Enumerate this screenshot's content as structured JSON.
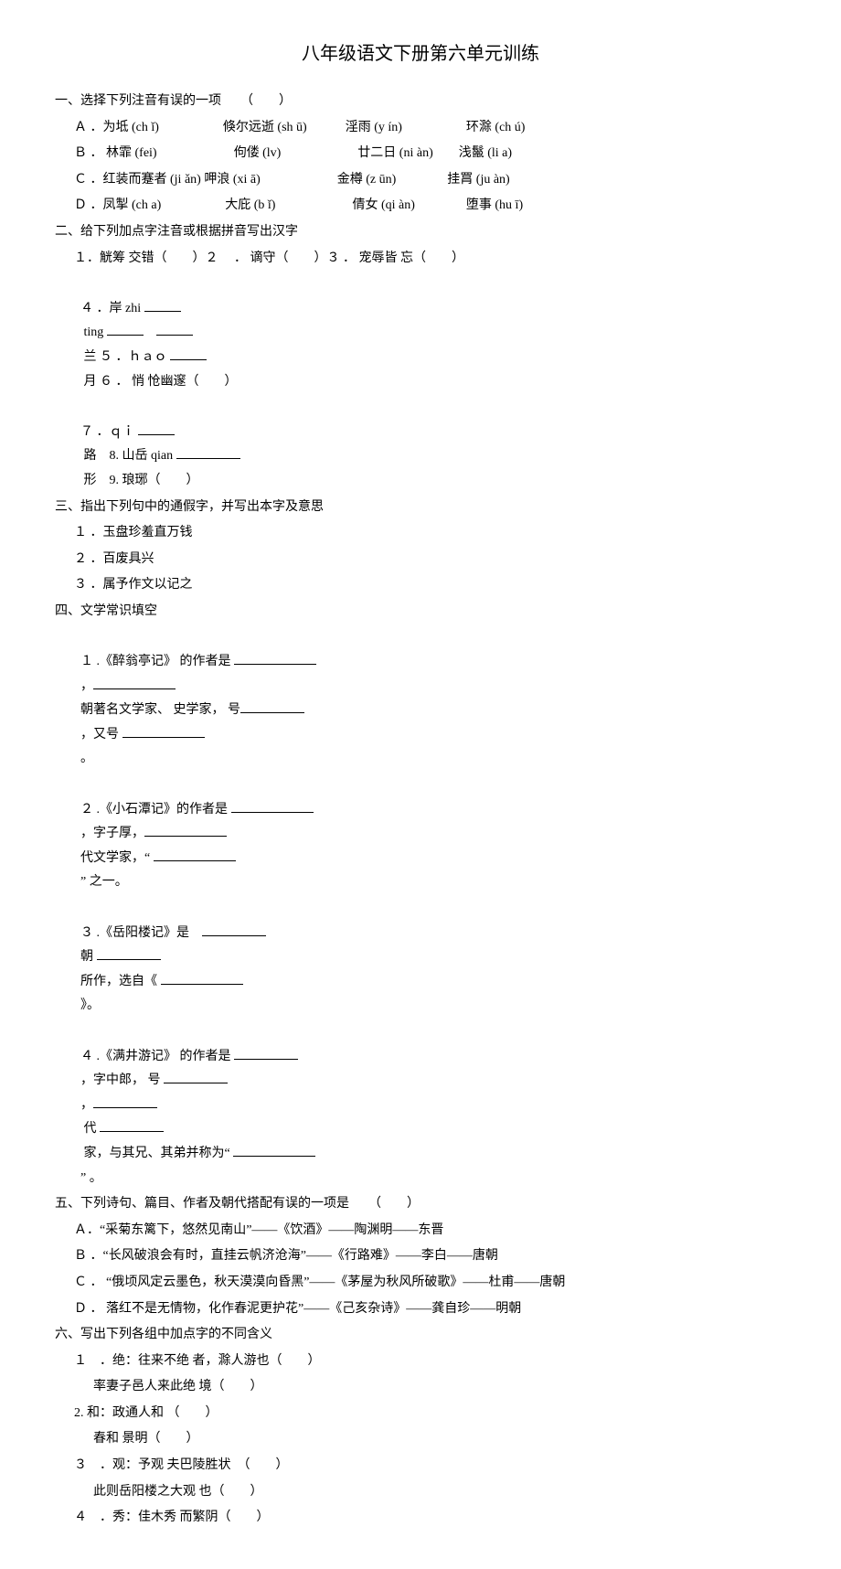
{
  "title": "八年级语文下册第六单元训练",
  "q1": {
    "heading": "一、选择下列注音有误的一项　　（　　）",
    "A": "Ａ ．为坻 (ch ǐ)　　　　　倏尔远逝 (sh ū)　　　淫雨 (y ín)　　　　　环滁 (ch ú)",
    "B": "Ｂ ． 林霏 (fei)　　　　　　佝偻 (lv)　　　　　　廿二日 (ni àn)　　浅鬣 (li a)",
    "C": "Ｃ ．红装而蹇者 (ji ǎn) 呷浪 (xi ā)　　　　　　金樽 (z ūn)　　　　挂罥 (ju àn)",
    "D": "Ｄ ．凤掣 (ch a)　　　　　大庇 (b ǐ)　　　　　　倩女 (qi àn)　　　　堕事 (hu ī)"
  },
  "q2": {
    "heading": "二、给下列加点字注音或根据拼音写出汉字",
    "l1a": "１．觥筹 交错（　　）２　 ． 谪守（　　）３ ． 宠辱皆 忘（　　）",
    "l4a": "４ ．岸 zhi ",
    "l4b": " ting ",
    "l4c": " 兰 ５ ．ｈａｏ ",
    "l4d": " 月 ６ ． 悄 怆幽邃（　　）",
    "l7a": "７ ．ｑｉ ",
    "l7b": " 路　8. 山岳 qian ",
    "l7c": " 形　9. 琅琊（　　）"
  },
  "q3": {
    "heading": "三、指出下列句中的通假字，并写出本字及意思",
    "i1": "１ ．玉盘珍羞直万钱",
    "i2": "２ ．百废具兴",
    "i3": "３ ．属予作文以记之"
  },
  "q4": {
    "heading": "四、文学常识填空",
    "l1a": "１ .《醉翁亭记》 的作者是 ",
    "l1b": "，",
    "l1c": "朝著名文学家、 史学家， 号",
    "l1d": "，又号 ",
    "l1e": "。",
    "l2a": "２ .《小石潭记》的作者是 ",
    "l2b": "，字子厚，",
    "l2c": "代文学家，“ ",
    "l2d": "” 之一。",
    "l3a": "３ .《岳阳楼记》是　",
    "l3b": "朝 ",
    "l3c": "所作，选自《 ",
    "l3d": "》。",
    "l4a": "４ .《满井游记》 的作者是 ",
    "l4b": "，字中郎， 号 ",
    "l4c": "，",
    "l4d": " 代 ",
    "l4e": " 家，与其兄、其弟并称为“ ",
    "l4f": "” 。"
  },
  "q5": {
    "heading": "五、下列诗句、篇目、作者及朝代搭配有误的一项是　　（　　）",
    "A": "Ａ．“采菊东篱下，悠然见南山”——《饮酒》——陶渊明——东晋",
    "B": "Ｂ ．“长风破浪会有时，直挂云帆济沧海”——《行路难》——李白——唐朝",
    "C": "Ｃ ． “俄顷风定云墨色，秋天漠漠向昏黑”——《茅屋为秋风所破歌》——杜甫——唐朝",
    "D": "Ｄ ． 落红不是无情物，化作春泥更护花”——《己亥杂诗》——龚自珍——明朝"
  },
  "q6": {
    "heading": "六、写出下列各组中加点字的不同含义",
    "i1a": "１　．绝：往来不绝 者，滁人游也（　　）",
    "i1b": "率妻子邑人来此绝 境（　　）",
    "i2a": "2. 和：政通人和 （　　）",
    "i2b": "春和 景明（　　）",
    "i3a": "３　．观：予观 夫巴陵胜状　（　　）",
    "i3b": "此则岳阳楼之大观 也（　　）",
    "i4a": "４　．秀：佳木秀 而繁阴（　　）"
  }
}
